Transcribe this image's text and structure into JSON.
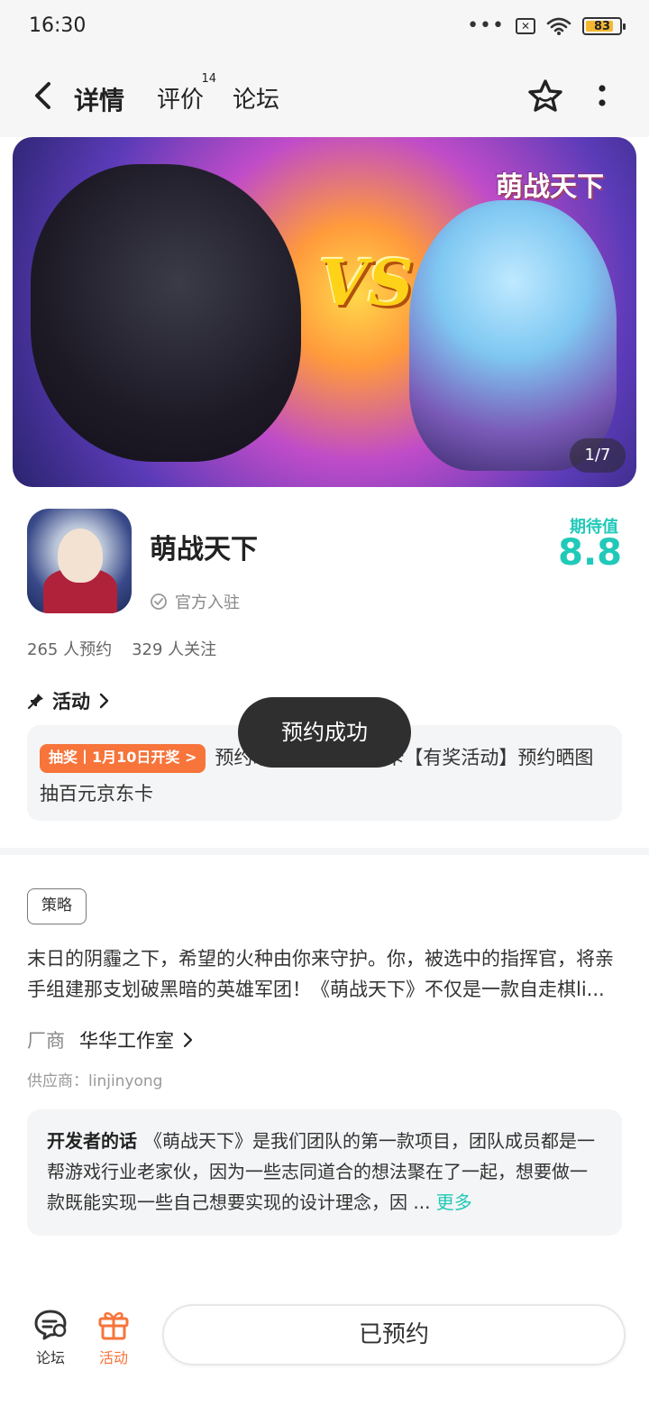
{
  "status_bar": {
    "time": "16:30",
    "dots": "•••",
    "battery": "83",
    "battery_level": 0.83,
    "battery_color": "#f3b830"
  },
  "header": {
    "tabs": [
      {
        "label": "详情",
        "active": true
      },
      {
        "label": "评价",
        "badge": "14"
      },
      {
        "label": "论坛"
      }
    ],
    "icons": [
      "back-icon",
      "star-icon",
      "more-icon"
    ]
  },
  "banner": {
    "title": "萌战天下",
    "vs": "VS",
    "counter": "1/7"
  },
  "game": {
    "name": "萌战天下",
    "verified": "官方入驻",
    "expect_label": "期待值",
    "expect_value": "8.8",
    "reservations": "265 人预约",
    "followers": "329 人关注",
    "accent_color": "#21c9b8"
  },
  "activity": {
    "heading": "活动",
    "tag": "抽奖丨1月10日开奖 >",
    "text": "预约晒图抽百元京东卡【有奖活动】预约晒图抽百元京东卡",
    "tag_color": "#f7743a"
  },
  "toast": "预约成功",
  "strategy_tag": "策略",
  "description": "末日的阴霾之下，希望的火种由你来守护。你，被选中的指挥官，将亲手组建那支划破黑暗的英雄军团！《萌战天下》不仅是一款自走棋li...",
  "vendor": {
    "label": "厂商",
    "name": "华华工作室"
  },
  "supplier": "供应商：linjinyong",
  "developer_note": {
    "title": "开发者的话",
    "text": "《萌战天下》是我们团队的第一款项目，团队成员都是一帮游戏行业老家伙，因为一些志同道合的想法聚在了一起，想要做一款既能实现一些自己想要实现的设计理念，因 ...",
    "more": "更多"
  },
  "bottom_bar": {
    "forum_label": "论坛",
    "activity_label": "活动",
    "action_label": "已预约"
  }
}
